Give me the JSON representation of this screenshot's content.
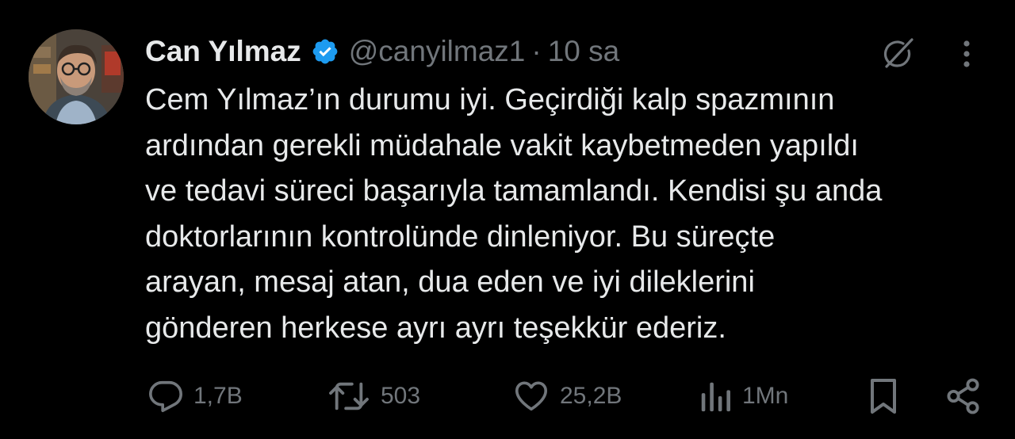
{
  "author": {
    "display_name": "Can Yılmaz",
    "handle": "@canyilmaz1",
    "separator": "·",
    "time": "10 sa",
    "verified_color": "#1d9bf0"
  },
  "tweet": {
    "lines": [
      "Cem Yılmaz’ın durumu iyi. Geçirdiği kalp spazmının",
      "ardından gerekli müdahale vakit kaybetmeden yapıldı",
      "ve tedavi süreci başarıyla tamamlandı. Kendisi şu anda",
      "doktorlarının kontrolünde dinleniyor. Bu süreçte",
      "arayan, mesaj atan, dua eden ve iyi dileklerini",
      "gönderen herkese ayrı ayrı teşekkür ederiz."
    ]
  },
  "actions": {
    "replies": "1,7B",
    "reposts": "503",
    "likes": "25,2B",
    "views": "1Mn"
  },
  "icons": {
    "grok": "grok-icon",
    "more": "more-icon",
    "reply": "reply-icon",
    "repost": "repost-icon",
    "like": "heart-icon",
    "views": "views-icon",
    "bookmark": "bookmark-icon",
    "share": "share-icon"
  },
  "colors": {
    "background": "#000000",
    "text": "#e7e9ea",
    "secondary": "#71767b"
  }
}
